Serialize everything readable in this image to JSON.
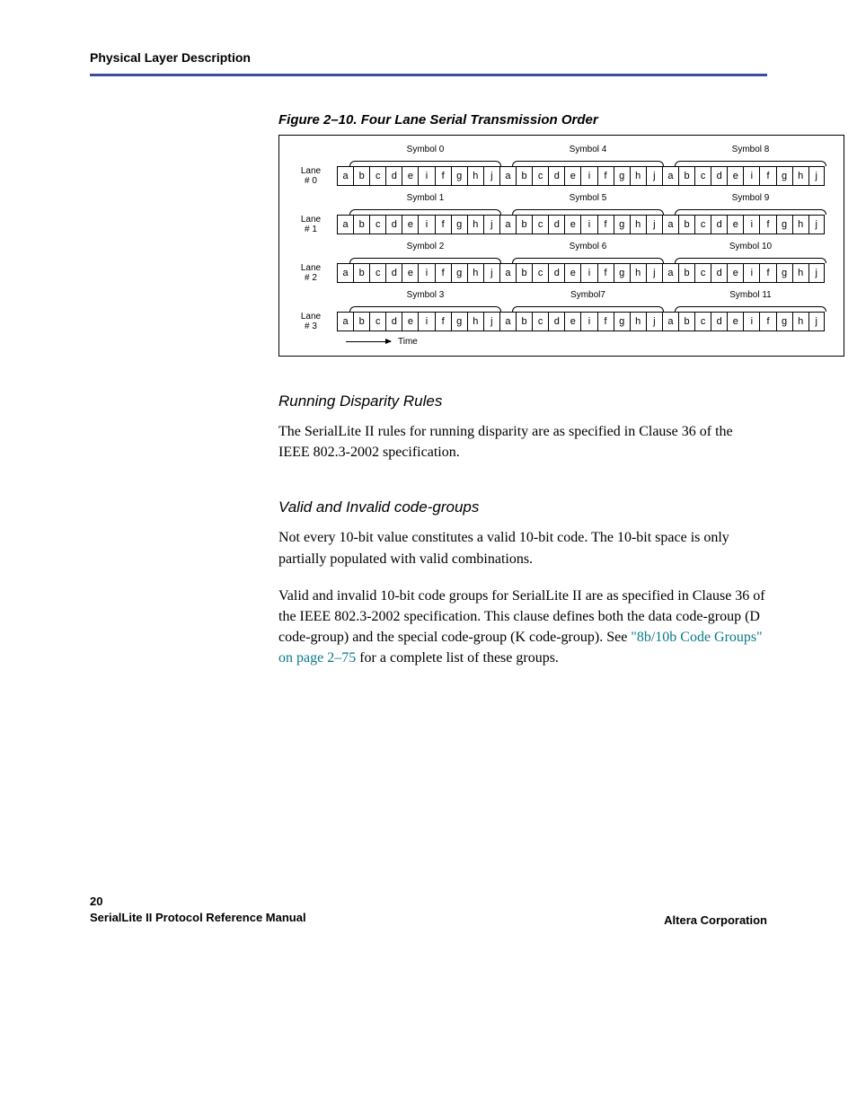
{
  "header": {
    "title": "Physical Layer Description"
  },
  "figure": {
    "caption": "Figure 2–10. Four Lane Serial Transmission Order",
    "bits": [
      "a",
      "b",
      "c",
      "d",
      "e",
      "i",
      "f",
      "g",
      "h",
      "j"
    ],
    "lanes": [
      {
        "label_line1": "Lane",
        "label_line2": "# 0",
        "symbols": [
          "Symbol  0",
          "Symbol  4",
          "Symbol  8"
        ]
      },
      {
        "label_line1": "Lane",
        "label_line2": "# 1",
        "symbols": [
          "Symbol  1",
          "Symbol  5",
          "Symbol  9"
        ]
      },
      {
        "label_line1": "Lane",
        "label_line2": "# 2",
        "symbols": [
          "Symbol  2",
          "Symbol  6",
          "Symbol  10"
        ]
      },
      {
        "label_line1": "Lane",
        "label_line2": "# 3",
        "symbols": [
          "Symbol  3",
          "Symbol7",
          "Symbol  11"
        ]
      }
    ],
    "time_label": "Time"
  },
  "sections": {
    "rdr_heading": "Running Disparity Rules",
    "rdr_p1": "The SerialLite II rules for running disparity are as specified in Clause 36 of the IEEE 802.3-2002 specification.",
    "cg_heading": "Valid and Invalid code-groups",
    "cg_p1": "Not every 10-bit value constitutes a valid 10-bit code. The 10-bit space is only partially populated with valid combinations.",
    "cg_p2a": "Valid and invalid 10-bit code groups for SerialLite II are as specified in Clause 36 of the IEEE 802.3-2002 specification. This clause defines both the data code-group (D code-group) and the special code-group (K code-group). See ",
    "cg_link": "\"8b/10b Code Groups\" on page 2–75",
    "cg_p2b": " for a complete list of these groups."
  },
  "footer": {
    "page_number": "20",
    "doc_title": "SerialLite II Protocol Reference Manual",
    "company": "Altera Corporation"
  }
}
